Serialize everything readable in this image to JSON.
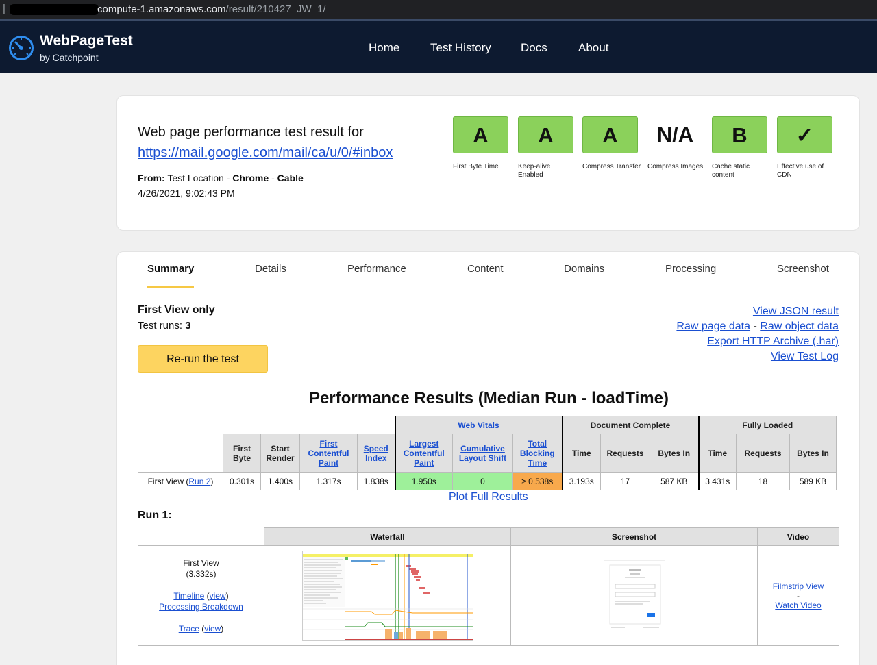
{
  "browser": {
    "url_visible": "compute-1.amazonaws.com",
    "url_path": "/result/210427_JW_1/"
  },
  "header": {
    "brand": "WebPageTest",
    "brand_sub": "by Catchpoint",
    "nav": [
      "Home",
      "Test History",
      "Docs",
      "About"
    ]
  },
  "summary_card": {
    "title": "Web page performance test result for",
    "test_url": "https://mail.google.com/mail/ca/u/0/#inbox",
    "from_label": "From:",
    "location": "Test Location",
    "browser": "Chrome",
    "connection": "Cable",
    "sep": "-",
    "date": "4/26/2021, 9:02:43 PM",
    "grades": [
      {
        "value": "A",
        "label": "First Byte Time",
        "style": "green"
      },
      {
        "value": "A",
        "label": "Keep-alive Enabled",
        "style": "green"
      },
      {
        "value": "A",
        "label": "Compress Transfer",
        "style": "green"
      },
      {
        "value": "N/A",
        "label": "Compress Images",
        "style": "na"
      },
      {
        "value": "B",
        "label": "Cache static content",
        "style": "green"
      },
      {
        "value": "✓",
        "label": "Effective use of CDN",
        "style": "green"
      }
    ],
    "colors": {
      "grade_green": "#8bd15b"
    }
  },
  "tabs": [
    "Summary",
    "Details",
    "Performance",
    "Content",
    "Domains",
    "Processing",
    "Screenshot"
  ],
  "active_tab": "Summary",
  "results": {
    "view_title": "First View only",
    "runs_label": "Test runs:",
    "runs": "3",
    "rerun": "Re-run the test",
    "links": {
      "json": "View JSON result",
      "raw_page": "Raw page data",
      "dash": "-",
      "raw_object": "Raw object data",
      "har": "Export HTTP Archive (.har)",
      "log": "View Test Log"
    },
    "perf_title": "Performance Results (Median Run - loadTime)",
    "group_headers": {
      "web_vitals": "Web Vitals",
      "doc_complete": "Document Complete",
      "fully_loaded": "Fully Loaded"
    },
    "columns": {
      "first_byte": "First Byte",
      "start_render": "Start Render",
      "fcp": "First Contentful Paint",
      "speed_index": "Speed Index",
      "lcp": "Largest Contentful Paint",
      "cls": "Cumulative Layout Shift",
      "tbt": "Total Blocking Time",
      "time": "Time",
      "requests": "Requests",
      "bytes_in": "Bytes In"
    },
    "row": {
      "label_prefix": "First View (",
      "run_link": "Run 2",
      "label_suffix": ")",
      "first_byte": "0.301s",
      "start_render": "1.400s",
      "fcp": "1.317s",
      "speed_index": "1.838s",
      "lcp": "1.950s",
      "cls": "0",
      "tbt": "≥ 0.538s",
      "dc_time": "3.193s",
      "dc_requests": "17",
      "dc_bytes": "587 KB",
      "fl_time": "3.431s",
      "fl_requests": "18",
      "fl_bytes": "589 KB"
    },
    "plot_link": "Plot Full Results",
    "run_title": "Run 1:",
    "run_table": {
      "headers": [
        "Waterfall",
        "Screenshot",
        "Video"
      ],
      "first_view": "First View",
      "load_time": "(3.332s)",
      "timeline": "Timeline",
      "view": "view",
      "processing": "Processing Breakdown",
      "trace": "Trace",
      "filmstrip": "Filmstrip View",
      "video_dash": "-",
      "watch": "Watch Video"
    }
  }
}
